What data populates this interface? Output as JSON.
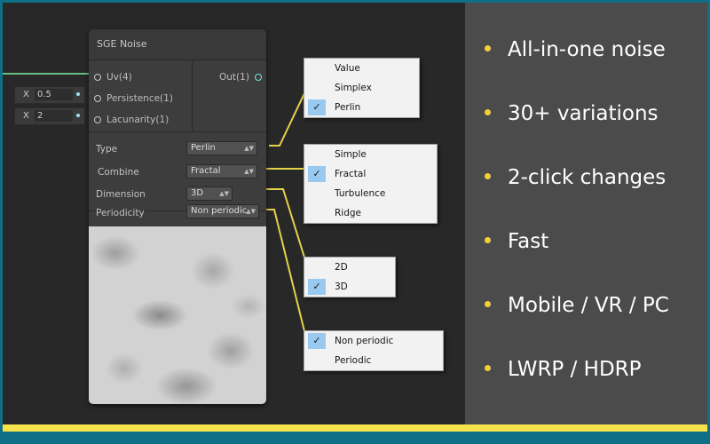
{
  "node": {
    "title": "SGE Noise",
    "inputs": [
      "Uv(4)",
      "Persistence(1)",
      "Lacunarity(1)"
    ],
    "output": "Out(1)",
    "properties": [
      {
        "label": "Type",
        "value": "Perlin"
      },
      {
        "label": "Combine",
        "value": "Fractal"
      },
      {
        "label": "Dimension",
        "value": "3D"
      },
      {
        "label": "Periodicity",
        "value": "Non periodic"
      }
    ]
  },
  "fields": [
    {
      "axis": "X",
      "value": "0.5"
    },
    {
      "axis": "X",
      "value": "2"
    }
  ],
  "popups": {
    "type": {
      "items": [
        "Value",
        "Simplex",
        "Perlin"
      ],
      "checked_index": 2
    },
    "combine": {
      "items": [
        "Simple",
        "Fractal",
        "Turbulence",
        "Ridge"
      ],
      "checked_index": 1
    },
    "dimension": {
      "items": [
        "2D",
        "3D"
      ],
      "checked_index": 1
    },
    "periodicity": {
      "items": [
        "Non periodic",
        "Periodic"
      ],
      "checked_index": 0
    }
  },
  "check_glyph": "✓",
  "bullets": [
    "All-in-one noise",
    "30+ variations",
    "2-click changes",
    "Fast",
    "Mobile / VR / PC",
    "LWRP / HDRP"
  ],
  "colors": {
    "accent_wire": "#e4d24a",
    "uv_wire": "#7ff0a0",
    "bullet_dot": "#f2cf3b",
    "frame": "#0f6f86",
    "bottom_stripe": "#f6e24a"
  }
}
